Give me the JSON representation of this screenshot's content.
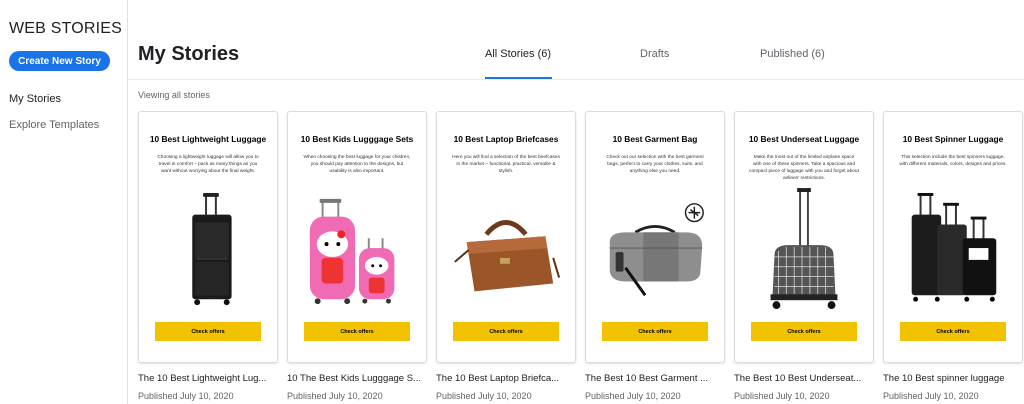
{
  "sidebar": {
    "brand": "WEB STORIES",
    "create_button": "Create New Story",
    "nav": [
      "My Stories",
      "Explore Templates"
    ]
  },
  "header": {
    "title": "My Stories",
    "tabs": [
      "All Stories (6)",
      "Drafts",
      "Published (6)"
    ],
    "active_tab": "All Stories (6)",
    "viewing_label": "Viewing all stories"
  },
  "accent": "#1a73e8",
  "cta_color": "#f2c200",
  "cards": [
    {
      "title": "10 Best Lightweight Luggage",
      "description": "Choosing a lightweight luggage will allow you to travel in comfort – pack as many things as you want without worrying about the final weight.",
      "cta": "Check offers",
      "image": "black-rolling-suitcase",
      "name": "The 10 Best Lightweight Lug...",
      "published": "Published July 10, 2020"
    },
    {
      "title": "10  Best Kids Lugggage Sets",
      "description": "When choosing the best luggage for your children, you should pay attention to the designs, but usability is also important.",
      "cta": "Check offers",
      "image": "pink-kids-luggage-set",
      "name": "10 The Best Kids Lugggage S...",
      "published": "Published July 10, 2020"
    },
    {
      "title": "10 Best Laptop Briefcases",
      "description": "Here you will find a selection of the best briefcases in the market – functional, practical, versatile & stylish.",
      "cta": "Check offers",
      "image": "brown-leather-briefcase",
      "name": "The 10 Best Laptop Briefca...",
      "published": "Published July 10, 2020"
    },
    {
      "title": "10 Best Garment Bag",
      "description": "Check out our selection with the best garment bags, perfect to carry your clothes, suits, and anything else you need.",
      "cta": "Check offers",
      "image": "grey-garment-duffel",
      "name": "The Best 10 Best Garment ...",
      "published": "Published July 10, 2020"
    },
    {
      "title": "10 Best Underseat Luggage",
      "description": "Make the most out of the limited airplane space with one of these spinners. Take a spacious and compact piece of luggage with you and forget about airlines' restrictions.",
      "cta": "Check offers",
      "image": "plaid-underseat-roller",
      "name": "The Best 10 Best Underseat...",
      "published": "Published July 10, 2020"
    },
    {
      "title": "10 Best Spinner Luggage",
      "description": "This selection include the best spinners luggage, with different materials, colors, designs and prices.",
      "cta": "Check offers",
      "image": "black-spinner-set",
      "name": "The 10 Best spinner luggage",
      "published": "Published July 10, 2020"
    }
  ]
}
